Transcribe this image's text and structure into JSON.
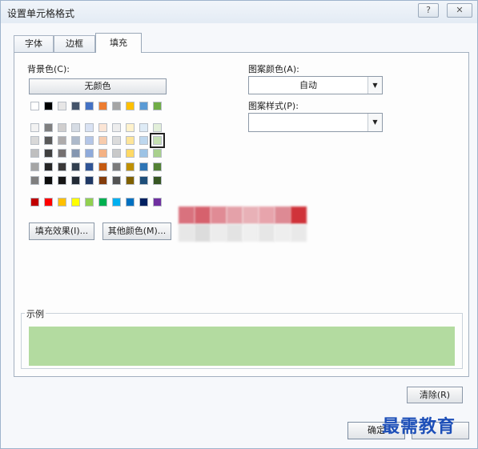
{
  "window": {
    "title": "设置单元格格式",
    "help_glyph": "?",
    "close_glyph": "✕"
  },
  "tabs": [
    {
      "label": "字体"
    },
    {
      "label": "边框"
    },
    {
      "label": "填充",
      "active": true
    }
  ],
  "fill": {
    "background_label": "背景色(C):",
    "no_color_label": "无颜色",
    "fill_effects_label": "填充效果(I)...",
    "more_colors_label": "其他颜色(M)...",
    "pattern_color_label": "图案颜色(A):",
    "pattern_color_value": "自动",
    "pattern_style_label": "图案样式(P):",
    "pattern_style_value": "",
    "sample_label": "示例",
    "sample_color": "#b3dba0"
  },
  "palette": {
    "row1": [
      "#ffffff",
      "#000000",
      "#e7e6e6",
      "#44546a",
      "#4472c4",
      "#ed7d31",
      "#a5a5a5",
      "#ffc000",
      "#5b9bd5",
      "#70ad47"
    ],
    "shades": [
      [
        "#f2f2f2",
        "#7f7f7f",
        "#d0cece",
        "#d6dce4",
        "#d9e2f3",
        "#fbe5d5",
        "#ededed",
        "#fff2cc",
        "#deebf6",
        "#e2efd9"
      ],
      [
        "#d8d8d8",
        "#595959",
        "#aeabab",
        "#adb9ca",
        "#b4c6e7",
        "#f7cbac",
        "#dbdbdb",
        "#fee599",
        "#bdd7ee",
        "#c5e0b3"
      ],
      [
        "#bfbfbf",
        "#3f3f3f",
        "#757070",
        "#8496b0",
        "#8eaadb",
        "#f4b183",
        "#c9c9c9",
        "#ffd965",
        "#9cc3e5",
        "#a8d08d"
      ],
      [
        "#a5a5a5",
        "#262626",
        "#3a3838",
        "#323f4f",
        "#2f5496",
        "#c55a11",
        "#7b7b7b",
        "#bf9000",
        "#2e75b5",
        "#538135"
      ],
      [
        "#7f7f7f",
        "#0c0c0c",
        "#171616",
        "#222a35",
        "#1f3864",
        "#833c0b",
        "#525252",
        "#7f6000",
        "#1e4e79",
        "#375623"
      ]
    ],
    "standard": [
      "#c00000",
      "#ff0000",
      "#ffc000",
      "#ffff00",
      "#92d050",
      "#00b050",
      "#00b0f0",
      "#0070c0",
      "#002060",
      "#7030a0"
    ],
    "selected": "#c5e0b3"
  },
  "buttons": {
    "clear_label": "清除(R)",
    "ok_label": "确定",
    "cancel_label": ""
  },
  "watermark": "最需教育"
}
